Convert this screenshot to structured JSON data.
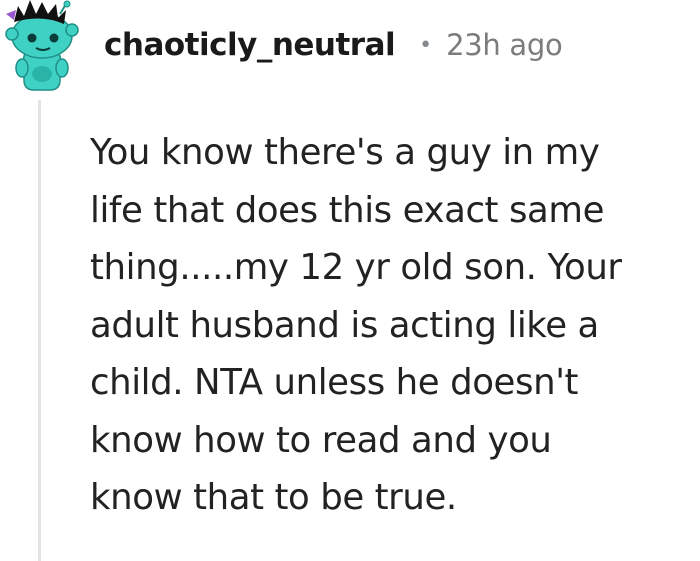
{
  "comment": {
    "username": "chaoticly_neutral",
    "separator": "•",
    "timestamp": "23h ago",
    "body_lines": [
      "You know there's a guy in my",
      "life that does this exact same",
      "thing.....my 12 yr old son. Your",
      "adult husband is acting like a",
      "child. NTA unless he doesn't",
      "know how to read and you",
      "know that to be true."
    ]
  },
  "avatar": {
    "icon": "snoo-avatar-icon",
    "colors": {
      "skin": "#3fd1c4",
      "skin_shadow": "#2ab3a7",
      "hair": "#111111",
      "accent": "#9b59d0"
    }
  }
}
